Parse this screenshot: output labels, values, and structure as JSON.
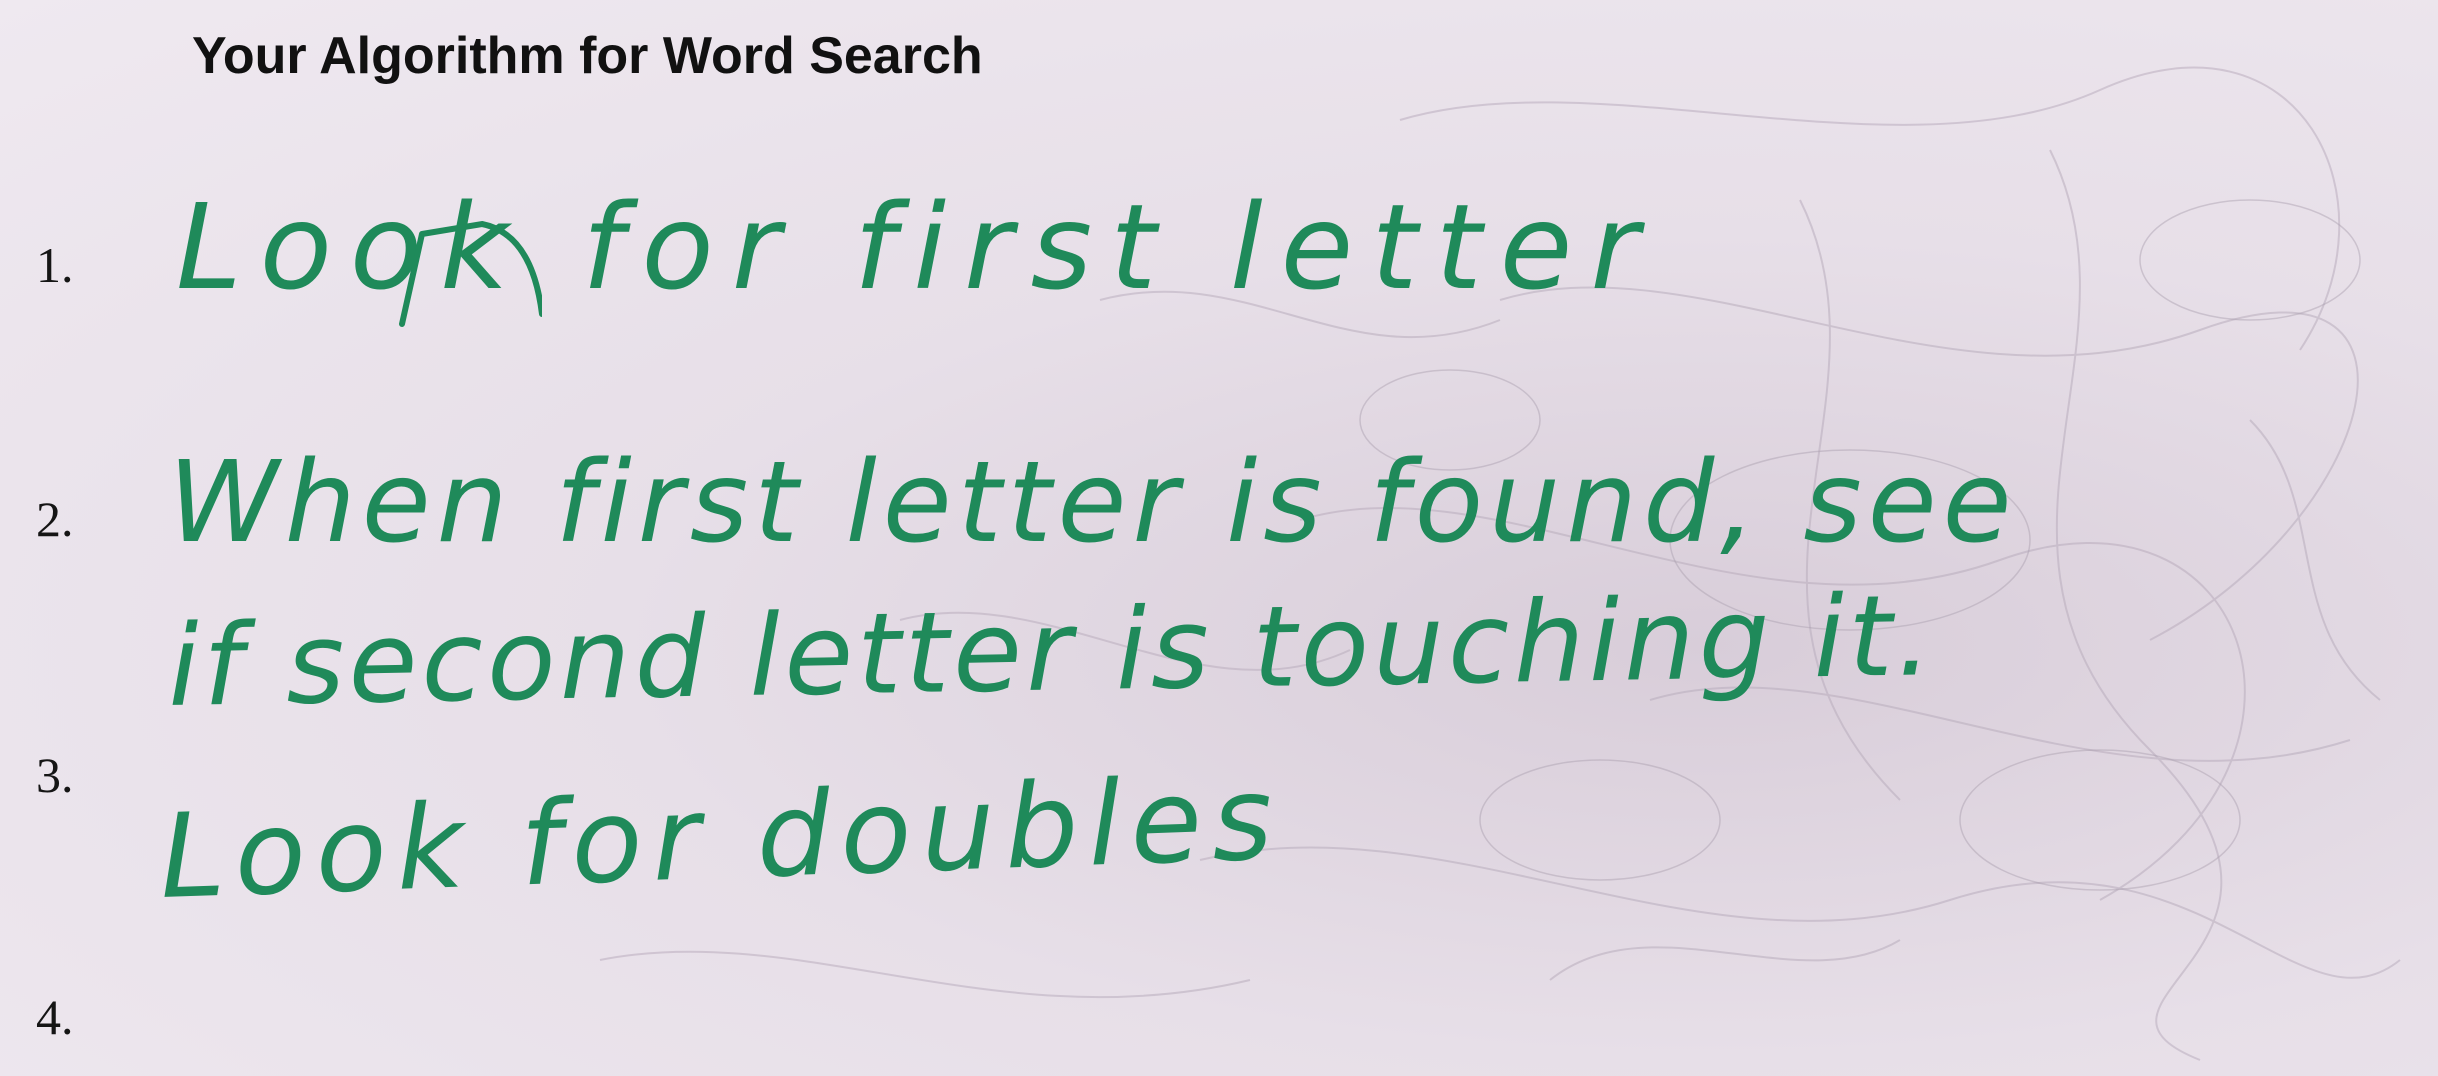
{
  "worksheet": {
    "title": "Your Algorithm for Word Search"
  },
  "items": [
    {
      "number": "1.",
      "text": "Look for first letter"
    },
    {
      "number": "2.",
      "text_line1": "When first letter is found, see",
      "text_line2": "if second letter is touching it."
    },
    {
      "number": "3.",
      "text": "Look for doubles"
    },
    {
      "number": "4.",
      "text": ""
    }
  ],
  "colors": {
    "ink": "#1f8a5a",
    "paper": "#e7dfe8",
    "print": "#111111"
  }
}
